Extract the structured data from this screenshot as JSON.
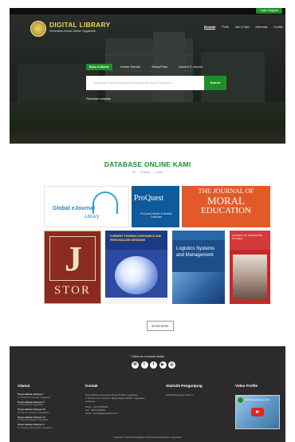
{
  "header": {
    "login_label": "Login Anggota",
    "brand_title": "DIGITAL LIBRARY",
    "brand_subtitle": "Universitas Ahmad Dahlan Yogyakarta",
    "nav": [
      "Beranda",
      "Profil",
      "Jam & Tata",
      "Informasi",
      "Kontak"
    ]
  },
  "search": {
    "tabs": [
      "Buku & Ebook",
      "Koleksi Sekolah",
      "Skripsi/Tesis",
      "Jurnal & E-Journal"
    ],
    "placeholder": "Masukkan Judul/Pengarang/Subjek/Kata Kunci Pencarian",
    "button_label": "Search",
    "advanced_label": "Pencarian Lanjutan"
  },
  "database": {
    "title": "DATABASE ONLINE KAMI",
    "filters": [
      "All",
      "E-Book",
      "Jurnal"
    ],
    "tiles": [
      {
        "name": "Global eJournal Library",
        "line1": "Global eJournal",
        "line2": "Library"
      },
      {
        "name": "ProQuest",
        "title": "ProQuest",
        "subtitle": "ProQuest Health & Medical Collection"
      },
      {
        "name": "Journal of Moral Education",
        "line1": "THE JOURNAL OF",
        "line2": "MORAL",
        "line3": "EDUCATION"
      },
      {
        "name": "JSTOR",
        "letter": "J",
        "word": "STOR"
      },
      {
        "name": "Current Pharmacogenomics",
        "title": "CURRENT PHARMACOGENOMICS AND PERSONALIZED MEDICINE"
      },
      {
        "name": "Logistics Systems and Management",
        "title": "Logistics Systems and Management"
      },
      {
        "name": "Red Journal",
        "title": "JOURNAL OF LANDSCAPE STUDIES"
      }
    ],
    "show_more_label": "SHOW MORE"
  },
  "footer": {
    "follow_label": "Follow us on social media",
    "socials": [
      {
        "icon": "mail-icon",
        "glyph": "✉"
      },
      {
        "icon": "twitter-icon",
        "glyph": "t"
      },
      {
        "icon": "facebook-icon",
        "glyph": "f"
      },
      {
        "icon": "youtube-icon",
        "glyph": "▶"
      },
      {
        "icon": "instagram-icon",
        "glyph": "◎"
      }
    ],
    "address_title": "Alamat",
    "addresses": [
      {
        "name": "Perpustakaan Kampus I",
        "line": "Jl. Kapas No.9 Semaki Yogyakarta"
      },
      {
        "name": "Perpustakaan Kampus II",
        "line": "Jl. Pramuka 42 Yogyakarta"
      },
      {
        "name": "Perpustakaan Kampus III",
        "line": "Jl. Prof. Dr. Soepomo Yogyakarta"
      },
      {
        "name": "Perpustakaan Kampus IV",
        "line": "Jl. Ringroad Selatan Yogyakarta"
      },
      {
        "name": "Perpustakaan Kampus V",
        "line": "Jl. Ki Ageng Pemanahan Yogyakarta"
      }
    ],
    "contact_title": "Kontak",
    "contact_lines": [
      "Perpustakaan Universitas Ahmad Dahlan Yogyakarta",
      "Jl. Ahmad Yani, Tamanan, Banguntapan, Bantul, Yogyakarta",
      "Indonesia",
      "Phone : (0274) 563515",
      "Fax : (0274) 564604",
      "Email : perpustakaan@uad.ac.id"
    ],
    "stats_title": "Statistik Pengunjung",
    "stats_line": "Grafik Pengunjung bulan ini",
    "video_title": "Video Profile",
    "video_caption": "Profil Perpustakaan UAD",
    "copyright": "Copyright © 2022 Perpustakaan Universitas Ahmad Dahlan Yogyakarta"
  }
}
